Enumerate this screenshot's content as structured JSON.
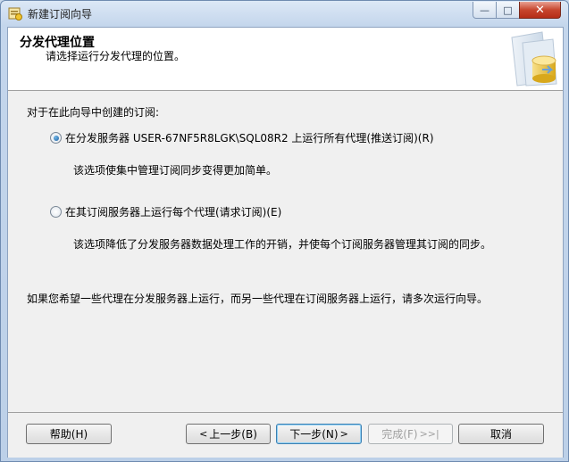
{
  "window": {
    "title": "新建订阅向导",
    "controls": {
      "minimize": "—",
      "maximize": "□",
      "close": "✕"
    }
  },
  "header": {
    "title": "分发代理位置",
    "subtitle": "请选择运行分发代理的位置。",
    "art_icon": "database-wizard-icon"
  },
  "body": {
    "prompt": "对于在此向导中创建的订阅:",
    "options": [
      {
        "label": "在分发服务器 USER-67NF5R8LGK\\SQL08R2 上运行所有代理(推送订阅)(R)",
        "checked": true,
        "description": "该选项使集中管理订阅同步变得更加简单。"
      },
      {
        "label": "在其订阅服务器上运行每个代理(请求订阅)(E)",
        "checked": false,
        "description": "该选项降低了分发服务器数据处理工作的开销，并使每个订阅服务器管理其订阅的同步。"
      }
    ],
    "note": "如果您希望一些代理在分发服务器上运行，而另一些代理在订阅服务器上运行，请多次运行向导。"
  },
  "buttons": {
    "help": "帮助(H)",
    "back": "上一步(B)",
    "back_arrow": "<",
    "next": "下一步(N)",
    "next_arrow": ">",
    "finish": "完成(F)",
    "finish_arrow": ">>|",
    "cancel": "取消"
  }
}
